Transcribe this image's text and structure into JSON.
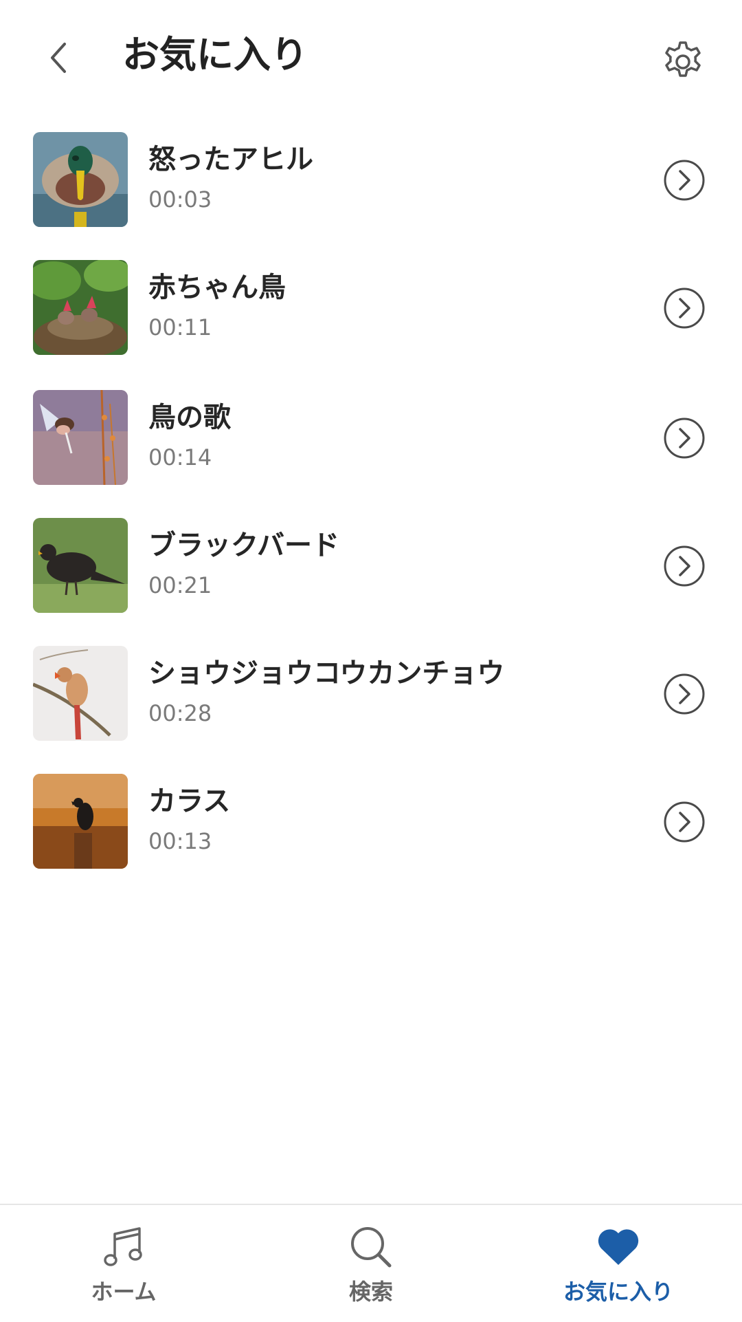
{
  "header": {
    "title": "お気に入り",
    "back_icon": "chevron-left-icon",
    "settings_icon": "gear-icon"
  },
  "favorites": [
    {
      "title": "怒ったアヒル",
      "duration": "00:03",
      "image": "mallard-duck"
    },
    {
      "title": "赤ちゃん鳥",
      "duration": "00:11",
      "image": "baby-birds-nest"
    },
    {
      "title": "鳥の歌",
      "duration": "00:14",
      "image": "songbird-flying"
    },
    {
      "title": "ブラックバード",
      "duration": "00:21",
      "image": "blackbird-on-grass"
    },
    {
      "title": "ショウジョウコウカンチョウ",
      "duration": "00:28",
      "image": "cardinal-on-branch"
    },
    {
      "title": "カラス",
      "duration": "00:13",
      "image": "crow-on-post"
    }
  ],
  "bottom_nav": {
    "items": [
      {
        "label": "ホーム",
        "icon": "music-note-icon",
        "active": false
      },
      {
        "label": "検索",
        "icon": "search-icon",
        "active": false
      },
      {
        "label": "お気に入り",
        "icon": "heart-icon",
        "active": true
      }
    ]
  },
  "colors": {
    "accent": "#1c5ea8",
    "text_primary": "#262626",
    "text_secondary": "#7a7a7a",
    "icon": "#555555"
  }
}
